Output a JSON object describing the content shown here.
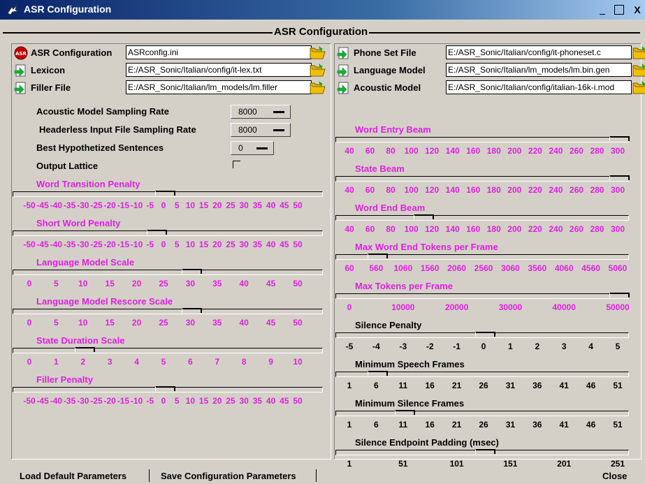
{
  "window": {
    "title": "ASR Configuration",
    "min": "_",
    "max": "□",
    "close": "X"
  },
  "frame_title": "ASR Configuration",
  "files_left": [
    {
      "label": "ASR Configuration",
      "value": "ASRconfig.ini",
      "icon": "asr-logo-icon"
    },
    {
      "label": "Lexicon",
      "value": "E:/ASR_Sonic/Italian/config/it-lex.txt",
      "icon": "file-arrow-icon"
    },
    {
      "label": "Filler File",
      "value": "E:/ASR_Sonic/Italian/lm_models/lm.filler",
      "icon": "file-arrow-icon"
    }
  ],
  "files_right": [
    {
      "label": "Phone Set File",
      "value": "E:/ASR_Sonic/Italian/config/it-phoneset.c",
      "icon": "file-arrow-icon"
    },
    {
      "label": "Language Model",
      "value": "E:/ASR_Sonic/Italian/lm_models/lm.bin.gen",
      "icon": "file-arrow-icon"
    },
    {
      "label": "Acoustic Model",
      "value": "E:/ASR_Sonic/Italian/config/italian-16k-i.mod",
      "icon": "file-arrow-icon"
    }
  ],
  "params": [
    {
      "label": "Acoustic Model Sampling Rate",
      "value": "8000"
    },
    {
      "label": "Headerless Input File Sampling Rate",
      "value": "8000"
    },
    {
      "label": "Best Hypothetized Sentences",
      "value": "0"
    },
    {
      "label": "Output Lattice",
      "checked": false
    }
  ],
  "sliders_left": [
    {
      "label": "Word Transition Penalty",
      "color": "#e020e0",
      "ticks": [
        "-50",
        "-45",
        "-40",
        "-35",
        "-30",
        "-25",
        "-20",
        "-15",
        "-10",
        "-5",
        "0",
        "5",
        "10",
        "15",
        "20",
        "25",
        "30",
        "35",
        "40",
        "45",
        "50"
      ],
      "thumb": 0.5
    },
    {
      "label": "Short Word Penalty",
      "color": "#e020e0",
      "ticks": [
        "-50",
        "-45",
        "-40",
        "-35",
        "-30",
        "-25",
        "-20",
        "-15",
        "-10",
        "-5",
        "0",
        "5",
        "10",
        "15",
        "20",
        "25",
        "30",
        "35",
        "40",
        "45",
        "50"
      ],
      "thumb": 0.47
    },
    {
      "label": "Language Model Scale",
      "color": "#e020e0",
      "ticks": [
        "0",
        "5",
        "10",
        "15",
        "20",
        "25",
        "30",
        "35",
        "40",
        "45",
        "50"
      ],
      "thumb": 0.6
    },
    {
      "label": "Language Model Rescore Scale",
      "color": "#e020e0",
      "ticks": [
        "0",
        "5",
        "10",
        "15",
        "20",
        "25",
        "30",
        "35",
        "40",
        "45",
        "50"
      ],
      "thumb": 0.6
    },
    {
      "label": "State Duration Scale",
      "color": "#e020e0",
      "ticks": [
        "0",
        "1",
        "2",
        "3",
        "4",
        "5",
        "6",
        "7",
        "8",
        "9",
        "10"
      ],
      "thumb": 0.2
    },
    {
      "label": "Filler Penalty",
      "color": "#e020e0",
      "ticks": [
        "-50",
        "-45",
        "-40",
        "-35",
        "-30",
        "-25",
        "-20",
        "-15",
        "-10",
        "-5",
        "0",
        "5",
        "10",
        "15",
        "20",
        "25",
        "30",
        "35",
        "40",
        "45",
        "50"
      ],
      "thumb": 0.5
    }
  ],
  "sliders_right": [
    {
      "label": "Word Entry Beam",
      "color": "#e020e0",
      "ticks": [
        "40",
        "60",
        "80",
        "100",
        "120",
        "140",
        "160",
        "180",
        "200",
        "220",
        "240",
        "260",
        "280",
        "300"
      ],
      "thumb": 1.0
    },
    {
      "label": "State Beam",
      "color": "#e020e0",
      "ticks": [
        "40",
        "60",
        "80",
        "100",
        "120",
        "140",
        "160",
        "180",
        "200",
        "220",
        "240",
        "260",
        "280",
        "300"
      ],
      "thumb": 1.0
    },
    {
      "label": "Word End Beam",
      "color": "#e020e0",
      "ticks": [
        "40",
        "60",
        "80",
        "100",
        "120",
        "140",
        "160",
        "180",
        "200",
        "220",
        "240",
        "260",
        "280",
        "300"
      ],
      "thumb": 0.27
    },
    {
      "label": "Max Word End Tokens per Frame",
      "color": "#e020e0",
      "ticks": [
        "60",
        "560",
        "1060",
        "1560",
        "2060",
        "2560",
        "3060",
        "3560",
        "4060",
        "4560",
        "5060"
      ],
      "thumb": 0.1
    },
    {
      "label": "Max Tokens per Frame",
      "color": "#e020e0",
      "ticks": [
        "0",
        "10000",
        "20000",
        "30000",
        "40000",
        "50000"
      ],
      "thumb": 1.0
    },
    {
      "label": "Silence Penalty",
      "color": "#000000",
      "ticks": [
        "-5",
        "-4",
        "-3",
        "-2",
        "-1",
        "0",
        "1",
        "2",
        "3",
        "4",
        "5"
      ],
      "thumb": 0.5
    },
    {
      "label": "Minimum Speech Frames",
      "color": "#000000",
      "ticks": [
        "1",
        "6",
        "11",
        "16",
        "21",
        "26",
        "31",
        "36",
        "41",
        "46",
        "51"
      ],
      "thumb": 0.1
    },
    {
      "label": "Minimum Silence Frames",
      "color": "#000000",
      "ticks": [
        "1",
        "6",
        "11",
        "16",
        "21",
        "26",
        "31",
        "36",
        "41",
        "46",
        "51"
      ],
      "thumb": 0.2
    },
    {
      "label": "Silence Endpoint Padding (msec)",
      "color": "#000000",
      "ticks": [
        "1",
        "51",
        "101",
        "151",
        "201",
        "251"
      ],
      "thumb": 0.5
    }
  ],
  "buttons": {
    "load": "Load Default Parameters",
    "save": "Save Configuration Parameters",
    "close": "Close"
  }
}
